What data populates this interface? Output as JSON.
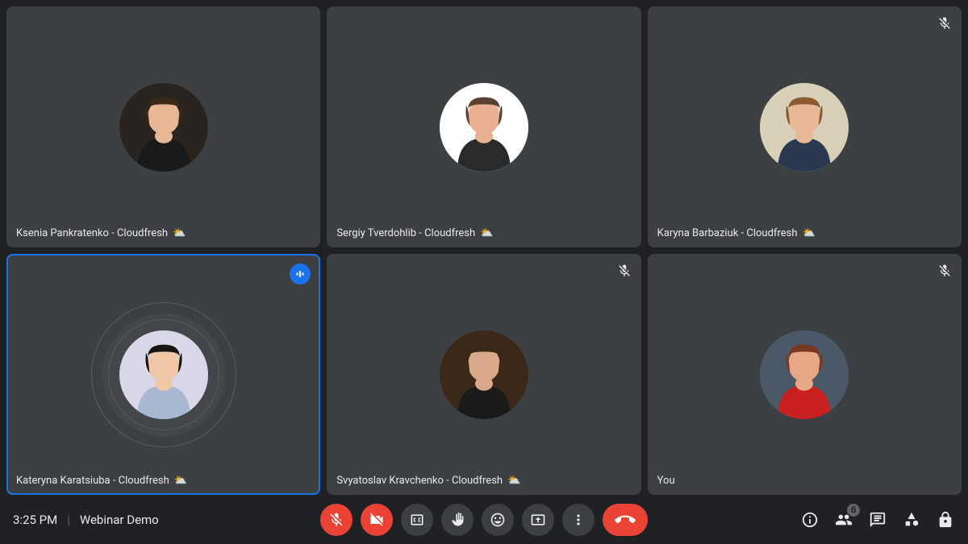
{
  "meeting": {
    "time": "3:25 PM",
    "title": "Webinar Demo"
  },
  "participants": [
    {
      "name": "Ksenia Pankratenko - Cloudfresh",
      "muted": false,
      "speaking": false,
      "self": false,
      "weather": "⛅",
      "avatar": {
        "bg": "#2a2420",
        "skin": "#e8b896",
        "hair": "#3a2818",
        "clothes": "#1a1a1a"
      }
    },
    {
      "name": "Sergiy Tverdohlib - Cloudfresh",
      "muted": false,
      "speaking": false,
      "self": false,
      "weather": "⛅",
      "avatar": {
        "bg": "#ffffff",
        "skin": "#e8b090",
        "hair": "#5a4030",
        "clothes": "#2a2a2a"
      }
    },
    {
      "name": "Karyna Barbaziuk - Cloudfresh",
      "muted": true,
      "speaking": false,
      "self": false,
      "weather": "⛅",
      "avatar": {
        "bg": "#d8d0b8",
        "skin": "#e8b896",
        "hair": "#8a5a30",
        "clothes": "#2a3850"
      }
    },
    {
      "name": "Kateryna Karatsiuba - Cloudfresh",
      "muted": false,
      "speaking": true,
      "self": false,
      "weather": "⛅",
      "avatar": {
        "bg": "#d8d8e8",
        "skin": "#f0c8a8",
        "hair": "#1a1410",
        "clothes": "#a8b8d0"
      }
    },
    {
      "name": "Svyatoslav Kravchenko - Cloudfresh",
      "muted": true,
      "speaking": false,
      "self": false,
      "weather": "⛅",
      "avatar": {
        "bg": "#3a2818",
        "skin": "#d8a888",
        "hair": "#3a2818",
        "clothes": "#1a1a1a"
      }
    },
    {
      "name": "You",
      "muted": true,
      "speaking": false,
      "self": true,
      "weather": "",
      "avatar": {
        "bg": "#4a5868",
        "skin": "#e8a888",
        "hair": "#7a3820",
        "clothes": "#c82020"
      }
    }
  ],
  "participant_count": "6",
  "controls": {
    "mic": "muted",
    "camera": "off"
  }
}
